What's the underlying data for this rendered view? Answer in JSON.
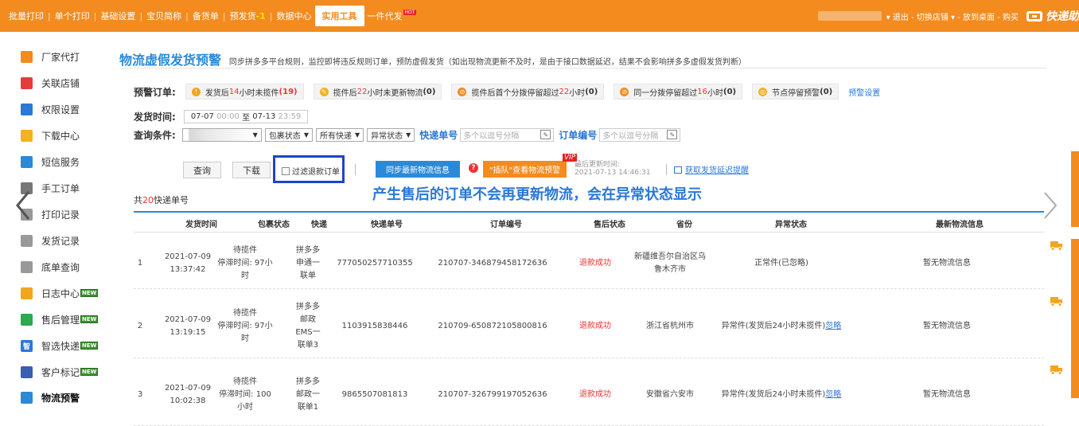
{
  "topbar": {
    "nav": [
      {
        "label": "批量打印"
      },
      {
        "label": "单个打印"
      },
      {
        "label": "基础设置"
      },
      {
        "label": "宝贝简称"
      },
      {
        "label": "备货单"
      },
      {
        "label": "预发货",
        "suffix": "-1"
      },
      {
        "label": "数据中心"
      },
      {
        "label": "实用工具",
        "active": true
      },
      {
        "label": "一件代发",
        "badge": "HOT"
      }
    ],
    "right_links": "▾ 退出 - 切换店铺 ▾ - 放到桌面 - 购买",
    "logo_text": "快递助"
  },
  "sidebar": {
    "items": [
      {
        "label": "厂家代打",
        "icon": "printer-icon",
        "color": "#f38b1f"
      },
      {
        "label": "关联店铺",
        "icon": "shop-icon",
        "color": "#e63b3b"
      },
      {
        "label": "权限设置",
        "icon": "lock-icon",
        "color": "#2b78d6"
      },
      {
        "label": "下载中心",
        "icon": "download-icon",
        "color": "#f3b21f"
      },
      {
        "label": "短信服务",
        "icon": "message-icon",
        "color": "#2b8ad8"
      },
      {
        "label": "手工订单",
        "icon": "keyboard-icon",
        "color": "#777"
      },
      {
        "label": "打印记录",
        "icon": "record-icon",
        "color": "#999"
      },
      {
        "label": "发货记录",
        "icon": "shipping-record-icon",
        "color": "#999"
      },
      {
        "label": "底单查询",
        "icon": "list-icon",
        "color": "#999"
      },
      {
        "label": "日志中心",
        "icon": "log-icon",
        "color": "#f3a51f",
        "new": "NEW"
      },
      {
        "label": "售后管理",
        "icon": "aftersale-icon",
        "color": "#2fa84f",
        "new": "NEW"
      },
      {
        "label": "智选快递",
        "icon": "smart-icon",
        "color": "#2b78d6",
        "new": "NEW",
        "glyph": "智"
      },
      {
        "label": "客户标记",
        "icon": "customer-icon",
        "color": "#3a5fb0",
        "new": "NEW"
      },
      {
        "label": "物流预警",
        "icon": "warning-icon",
        "color": "#2b8ad8",
        "active": true
      }
    ]
  },
  "header": {
    "title": "物流虚假发货预警",
    "desc": "同步拼多多平台规则，监控即将违反规则订单，预防虚假发货（如出现物流更新不及时，是由于接口数据延迟，结果不会影响拼多多虚假发货判断）"
  },
  "warnings": {
    "label": "预警订单:",
    "items": [
      {
        "pre": "发货后",
        "num": "14",
        "post": "小时未揽件",
        "count": "(19)",
        "icon": "alert-icon",
        "color": "#f3a51f"
      },
      {
        "pre": "揽件后",
        "num": "22",
        "post": "小时未更新物流",
        "count": "(0)",
        "icon": "pencil-icon",
        "color": "#f3b21f"
      },
      {
        "pre": "揽件后首个分拨停留超过",
        "num": "22",
        "post": "小时",
        "count": "(0)",
        "icon": "forbid-icon",
        "color": "#f38b1f"
      },
      {
        "pre": "同一分拨停留超过",
        "num": "16",
        "post": "小时",
        "count": "(0)",
        "icon": "forbid-icon",
        "color": "#f38b1f"
      },
      {
        "pre": "节点停留预警",
        "num": "",
        "post": "",
        "count": "(0)",
        "icon": "node-icon",
        "color": "#f3b21f"
      }
    ],
    "settings_link": "预警设置"
  },
  "filters": {
    "date_label": "发货时间:",
    "date_from": "07-07",
    "time_from": "00:00",
    "date_sep": "至",
    "date_to": "07-13",
    "time_to": "23:59",
    "query_label": "查询条件:",
    "selects": [
      "包裹状态",
      "所有快递",
      "异常状态"
    ],
    "tracking_label": "快递单号",
    "tracking_placeholder": "多个以逗号分隔",
    "order_label": "订单编号",
    "order_placeholder": "多个以逗号分隔"
  },
  "actions": {
    "query": "查询",
    "download": "下载",
    "filter_refund": "过滤退款订单",
    "sync": "同步最新物流信息",
    "plugin": "\"插队\"查看物流预警",
    "vip": "VIP",
    "last_update_label": "最后更新时间:",
    "last_update_value": "2021-07-13 14:46:31",
    "delay_link": "获取发货延迟提醒"
  },
  "annotation": "产生售后的订单不会再更新物流，会在异常状态显示",
  "summary": {
    "pre": "共",
    "num": "20",
    "post": "快递单号"
  },
  "table": {
    "columns": [
      "发货时间",
      "包裹状态",
      "快递",
      "快递单号",
      "订单编号",
      "售后状态",
      "省份",
      "异常状态",
      "最新物流信息"
    ],
    "rows": [
      {
        "idx": "1",
        "date": "2021-07-09",
        "time": "13:37:42",
        "status": [
          "待揽件",
          "停滞时间: 97小",
          "时"
        ],
        "express": [
          "拼多多",
          "申通一",
          "联单"
        ],
        "tracking": "777050257710355",
        "order": "210707-346879458172636",
        "aftersale": "退款成功",
        "province": [
          "新疆维吾尔自治区乌",
          "鲁木齐市"
        ],
        "exception": "正常件(已忽略)",
        "exception_link": "",
        "latest": "暂无物流信息"
      },
      {
        "idx": "2",
        "date": "2021-07-09",
        "time": "13:19:15",
        "status": [
          "待揽件",
          "停滞时间: 97小",
          "时"
        ],
        "express": [
          "拼多多",
          "邮政",
          "EMS一",
          "联单3"
        ],
        "tracking": "1103915838446",
        "order": "210709-650872105800816",
        "aftersale": "退款成功",
        "province": [
          "浙江省杭州市"
        ],
        "exception": "异常件(发货后24小时未揽件)",
        "exception_link": "忽略",
        "latest": "暂无物流信息"
      },
      {
        "idx": "3",
        "date": "2021-07-09",
        "time": "10:02:38",
        "status": [
          "待揽件",
          "停滞时间: 100",
          "小时"
        ],
        "express": [
          "拼多多",
          "邮政一",
          "联单1"
        ],
        "tracking": "9865507081813",
        "order": "210707-326799197052636",
        "aftersale": "退款成功",
        "province": [
          "安徽省六安市"
        ],
        "exception": "异常件(发货后24小时未揽件)",
        "exception_link": "忽略",
        "latest": "暂无物流信息"
      }
    ]
  }
}
